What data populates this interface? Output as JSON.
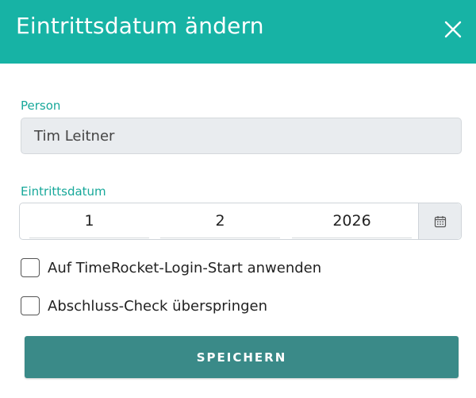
{
  "dialog": {
    "title": "Eintrittsdatum ändern",
    "close_icon": "close-icon"
  },
  "person": {
    "label": "Person",
    "value": "Tim Leitner"
  },
  "entry_date": {
    "label": "Eintrittsdatum",
    "day": "1",
    "month": "2",
    "year": "2026",
    "calendar_icon": "calendar-icon"
  },
  "options": [
    {
      "label": "Auf TimeRocket-Login-Start anwenden",
      "checked": false
    },
    {
      "label": "Abschluss-Check überspringen",
      "checked": false
    }
  ],
  "actions": {
    "save_label": "SPEICHERN"
  },
  "colors": {
    "header": "#17b3a5",
    "label": "#17a89a",
    "save_button": "#3a8a88"
  }
}
